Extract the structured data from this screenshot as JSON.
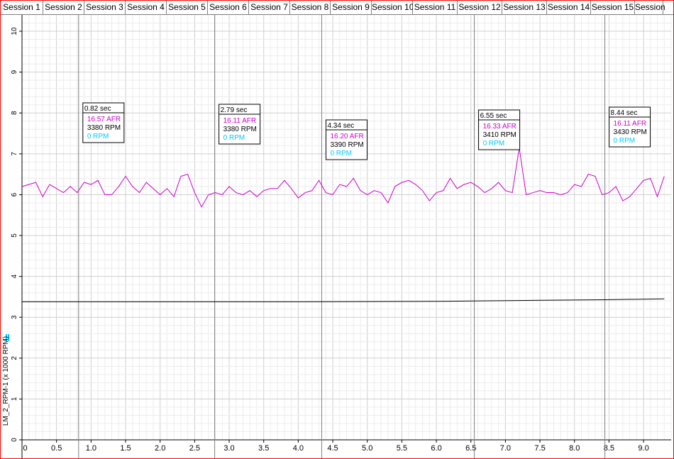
{
  "tabs": [
    "Session 1",
    "Session 2",
    "Session 3",
    "Session 4",
    "Session 5",
    "Session 6",
    "Session 7",
    "Session 8",
    "Session 9",
    "Session 10",
    "Session 11",
    "Session 12",
    "Session 13",
    "Session 14",
    "Session 15",
    "Session"
  ],
  "colors": {
    "afr": "#cc00cc",
    "rpm": "#000000",
    "rpm2": "#00c8ff",
    "border": "#ff0000",
    "grid": "#dcdcdc"
  },
  "chart_data": {
    "type": "line",
    "xlim": [
      0.0,
      9.4
    ],
    "ylim": [
      0,
      10.4
    ],
    "x_ticks": [
      ".0",
      "0.5",
      "1.0",
      "1.5",
      "2.0",
      "2.5",
      "3.0",
      "3.5",
      "4.0",
      "4.5",
      "5.0",
      "5.5",
      "6.0",
      "6.5",
      "7.0",
      "7.5",
      "8.0",
      "8.5",
      "9.0"
    ],
    "y_ticks": [
      "0",
      "1",
      "2",
      "3",
      "4",
      "5",
      "6",
      "7",
      "8",
      "9",
      "10"
    ],
    "ylabel": "LM_2_RPM-1 (x 1000 RPM)",
    "series": [
      {
        "name": "AFR",
        "x": [
          0.0,
          0.1,
          0.2,
          0.3,
          0.4,
          0.5,
          0.6,
          0.7,
          0.8,
          0.9,
          1.0,
          1.1,
          1.2,
          1.3,
          1.4,
          1.5,
          1.6,
          1.7,
          1.8,
          1.9,
          2.0,
          2.1,
          2.2,
          2.3,
          2.4,
          2.5,
          2.6,
          2.7,
          2.8,
          2.9,
          3.0,
          3.1,
          3.2,
          3.3,
          3.4,
          3.5,
          3.6,
          3.7,
          3.8,
          3.9,
          4.0,
          4.1,
          4.2,
          4.3,
          4.4,
          4.5,
          4.6,
          4.7,
          4.8,
          4.9,
          5.0,
          5.1,
          5.2,
          5.3,
          5.4,
          5.5,
          5.6,
          5.7,
          5.8,
          5.9,
          6.0,
          6.1,
          6.2,
          6.3,
          6.4,
          6.5,
          6.6,
          6.7,
          6.8,
          6.9,
          7.0,
          7.1,
          7.2,
          7.3,
          7.4,
          7.5,
          7.6,
          7.7,
          7.8,
          7.9,
          8.0,
          8.1,
          8.2,
          8.3,
          8.4,
          8.5,
          8.6,
          8.7,
          8.8,
          8.9,
          9.0,
          9.1,
          9.2,
          9.3
        ],
        "y": [
          6.2,
          6.25,
          6.3,
          5.95,
          6.25,
          6.15,
          6.05,
          6.2,
          6.05,
          6.3,
          6.25,
          6.35,
          6.0,
          6.0,
          6.2,
          6.45,
          6.2,
          6.05,
          6.3,
          6.15,
          6.0,
          6.15,
          5.95,
          6.45,
          6.5,
          6.05,
          5.7,
          6.0,
          6.05,
          6.0,
          6.2,
          6.05,
          6.0,
          6.1,
          5.95,
          6.1,
          6.15,
          6.15,
          6.35,
          6.15,
          5.92,
          6.05,
          6.1,
          6.35,
          6.05,
          6.0,
          6.25,
          6.2,
          6.4,
          6.1,
          6.0,
          6.1,
          6.05,
          5.8,
          6.2,
          6.3,
          6.35,
          6.25,
          6.1,
          5.85,
          6.05,
          6.1,
          6.4,
          6.15,
          6.25,
          6.3,
          6.2,
          6.05,
          6.15,
          6.3,
          6.1,
          6.05,
          7.15,
          6.0,
          6.05,
          6.1,
          6.05,
          6.05,
          6.0,
          6.05,
          6.25,
          6.2,
          6.5,
          6.45,
          6.0,
          6.05,
          6.2,
          5.85,
          5.95,
          6.15,
          6.35,
          6.4,
          5.95,
          6.45
        ]
      },
      {
        "name": "RPM",
        "x": [
          0.0,
          4.1,
          6.05,
          6.65,
          7.2,
          8.45,
          9.3
        ],
        "y": [
          3.38,
          3.38,
          3.39,
          3.4,
          3.41,
          3.43,
          3.45
        ]
      }
    ],
    "cursors": [
      {
        "x": 0.82,
        "time": "0.82 sec",
        "afr": "16.57 AFR",
        "rpm": "3380 RPM",
        "rpm2": "0 RPM"
      },
      {
        "x": 2.79,
        "time": "2.79 sec",
        "afr": "16.11 AFR",
        "rpm": "3380 RPM",
        "rpm2": "0 RPM"
      },
      {
        "x": 4.34,
        "time": "4.34 sec",
        "afr": "16.20 AFR",
        "rpm": "3390 RPM",
        "rpm2": "0 RPM"
      },
      {
        "x": 6.55,
        "time": "6.55 sec",
        "afr": "16.33 AFR",
        "rpm": "3410 RPM",
        "rpm2": "0 RPM"
      },
      {
        "x": 8.44,
        "time": "8.44 sec",
        "afr": "16.11 AFR",
        "rpm": "3430 RPM",
        "rpm2": "0 RPM"
      }
    ]
  }
}
